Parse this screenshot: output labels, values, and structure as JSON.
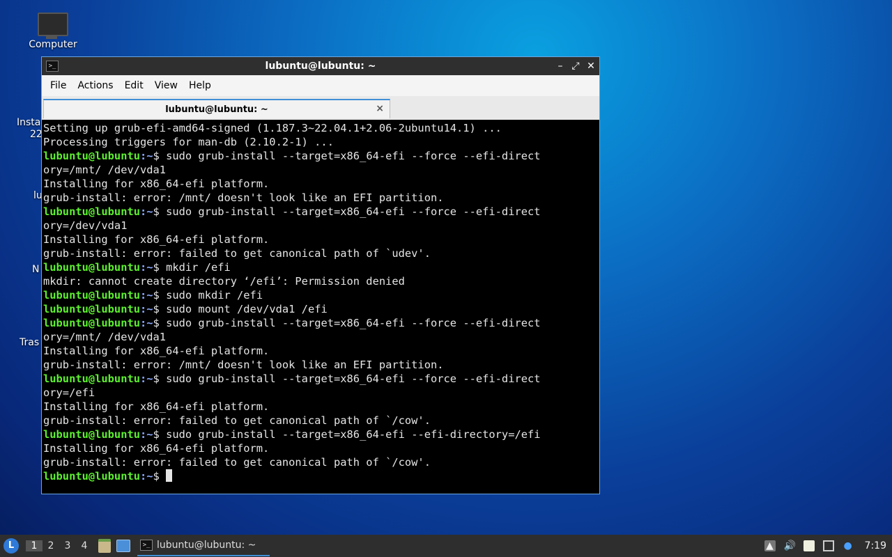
{
  "desktop": {
    "icons": [
      {
        "label": "Computer"
      },
      {
        "label": "Insta"
      },
      {
        "label": "22"
      },
      {
        "label": "lu"
      },
      {
        "label": "N"
      },
      {
        "label": "Tras"
      }
    ]
  },
  "window": {
    "title": "lubuntu@lubuntu: ~",
    "menu": [
      "File",
      "Actions",
      "Edit",
      "View",
      "Help"
    ],
    "tab_label": "lubuntu@lubuntu: ~",
    "minimize": "–",
    "maximize": "⤢",
    "close": "✕",
    "tab_close": "×"
  },
  "terminal": {
    "prompt_user": "lubuntu@lubuntu",
    "prompt_path": ":~",
    "prompt_sym": "$ ",
    "lines": [
      {
        "text": "Setting up grub-efi-amd64-signed (1.187.3~22.04.1+2.06-2ubuntu14.1) ..."
      },
      {
        "text": "Processing triggers for man-db (2.10.2-1) ..."
      },
      {
        "prompt": true,
        "text": "sudo grub-install --target=x86_64-efi --force --efi-direct"
      },
      {
        "text": "ory=/mnt/ /dev/vda1"
      },
      {
        "text": "Installing for x86_64-efi platform."
      },
      {
        "text": "grub-install: error: /mnt/ doesn't look like an EFI partition."
      },
      {
        "prompt": true,
        "text": "sudo grub-install --target=x86_64-efi --force --efi-direct"
      },
      {
        "text": "ory=/dev/vda1"
      },
      {
        "text": "Installing for x86_64-efi platform."
      },
      {
        "text": "grub-install: error: failed to get canonical path of `udev'."
      },
      {
        "prompt": true,
        "text": "mkdir /efi"
      },
      {
        "text": "mkdir: cannot create directory ‘/efi’: Permission denied"
      },
      {
        "prompt": true,
        "text": "sudo mkdir /efi"
      },
      {
        "prompt": true,
        "text": "sudo mount /dev/vda1 /efi"
      },
      {
        "prompt": true,
        "text": "sudo grub-install --target=x86_64-efi --force --efi-direct"
      },
      {
        "text": "ory=/mnt/ /dev/vda1"
      },
      {
        "text": "Installing for x86_64-efi platform."
      },
      {
        "text": "grub-install: error: /mnt/ doesn't look like an EFI partition."
      },
      {
        "prompt": true,
        "text": "sudo grub-install --target=x86_64-efi --force --efi-direct"
      },
      {
        "text": "ory=/efi"
      },
      {
        "text": "Installing for x86_64-efi platform."
      },
      {
        "text": "grub-install: error: failed to get canonical path of `/cow'."
      },
      {
        "prompt": true,
        "text": "sudo grub-install --target=x86_64-efi --efi-directory=/efi"
      },
      {
        "text": "Installing for x86_64-efi platform."
      },
      {
        "text": "grub-install: error: failed to get canonical path of `/cow'."
      },
      {
        "prompt": true,
        "text": "",
        "cursor": true
      }
    ]
  },
  "taskbar": {
    "workspaces": [
      "1",
      "2",
      "3",
      "4"
    ],
    "active_workspace": "1",
    "task_label": "lubuntu@lubuntu: ~",
    "clock": "7:19",
    "colors": {
      "accent": "#3f8fd6",
      "prompt_user": "#5cf02f",
      "prompt_path": "#8aa8ff"
    }
  }
}
